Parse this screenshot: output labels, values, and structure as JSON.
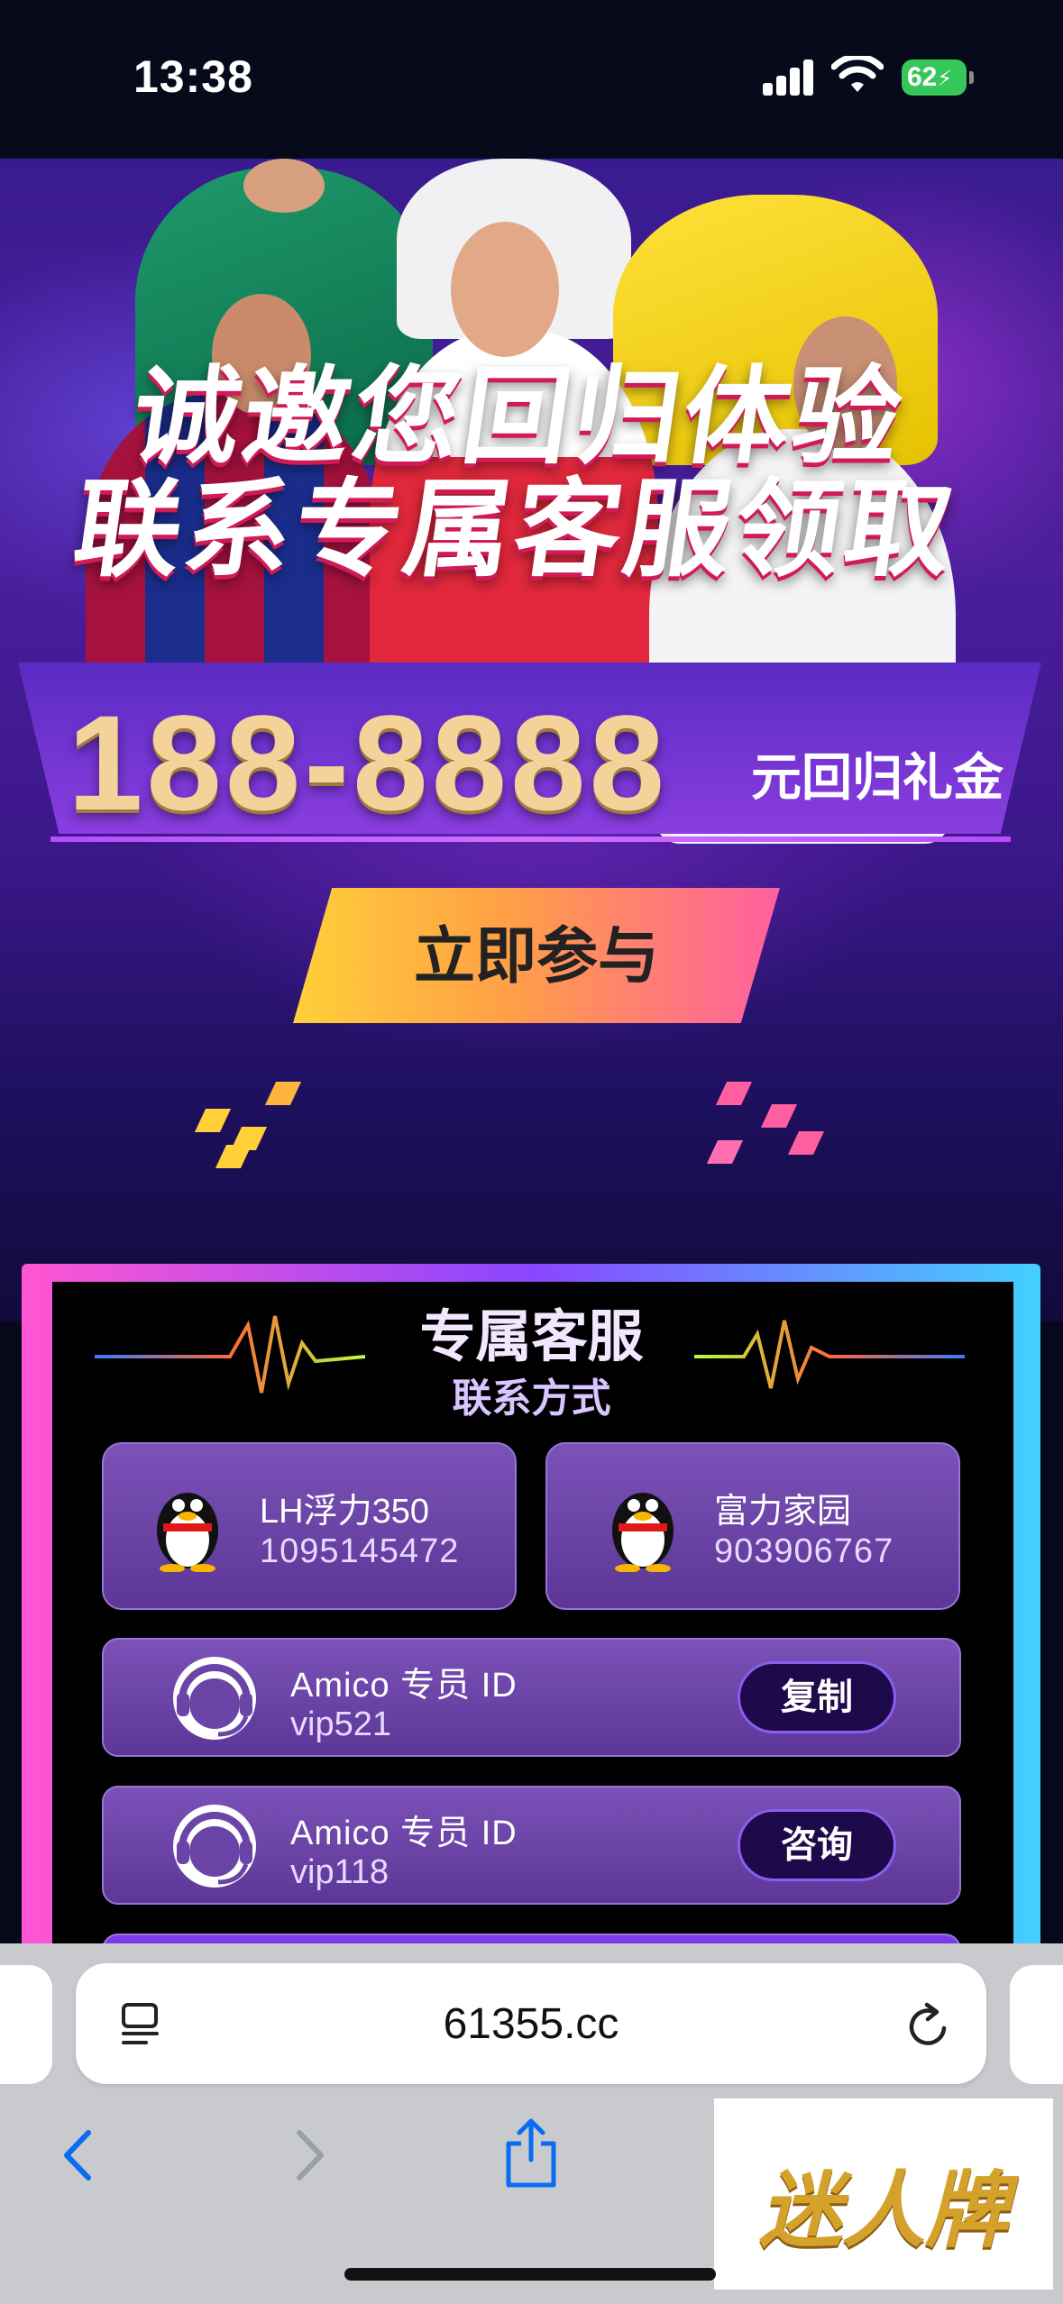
{
  "status_bar": {
    "time": "13:38",
    "battery": "62"
  },
  "promo": {
    "headline_1": "诚邀您回归体验",
    "headline_2": "联系专属客服领取",
    "amount": "188-8888",
    "amount_suffix": "元回归礼金",
    "cta_label": "立即参与"
  },
  "service_panel": {
    "title": "专属客服",
    "subtitle": "联系方式",
    "qq_contacts": [
      {
        "name": "LH浮力350",
        "number": "1095145472"
      },
      {
        "name": "富力家园",
        "number": "903906767"
      }
    ],
    "agents": [
      {
        "label": "Amico 专员 ID",
        "id": "vip521",
        "action": "复制"
      },
      {
        "label": "Amico 专员 ID",
        "id": "vip118",
        "action": "咨询"
      }
    ]
  },
  "browser": {
    "url": "61355.cc"
  },
  "watermark": "迷人牌",
  "colors": {
    "accent_purple": "#5c3796",
    "cta_yellow": "#ffd038",
    "cta_pink": "#ff5fa0",
    "amount_gold": "#f4d39a"
  }
}
